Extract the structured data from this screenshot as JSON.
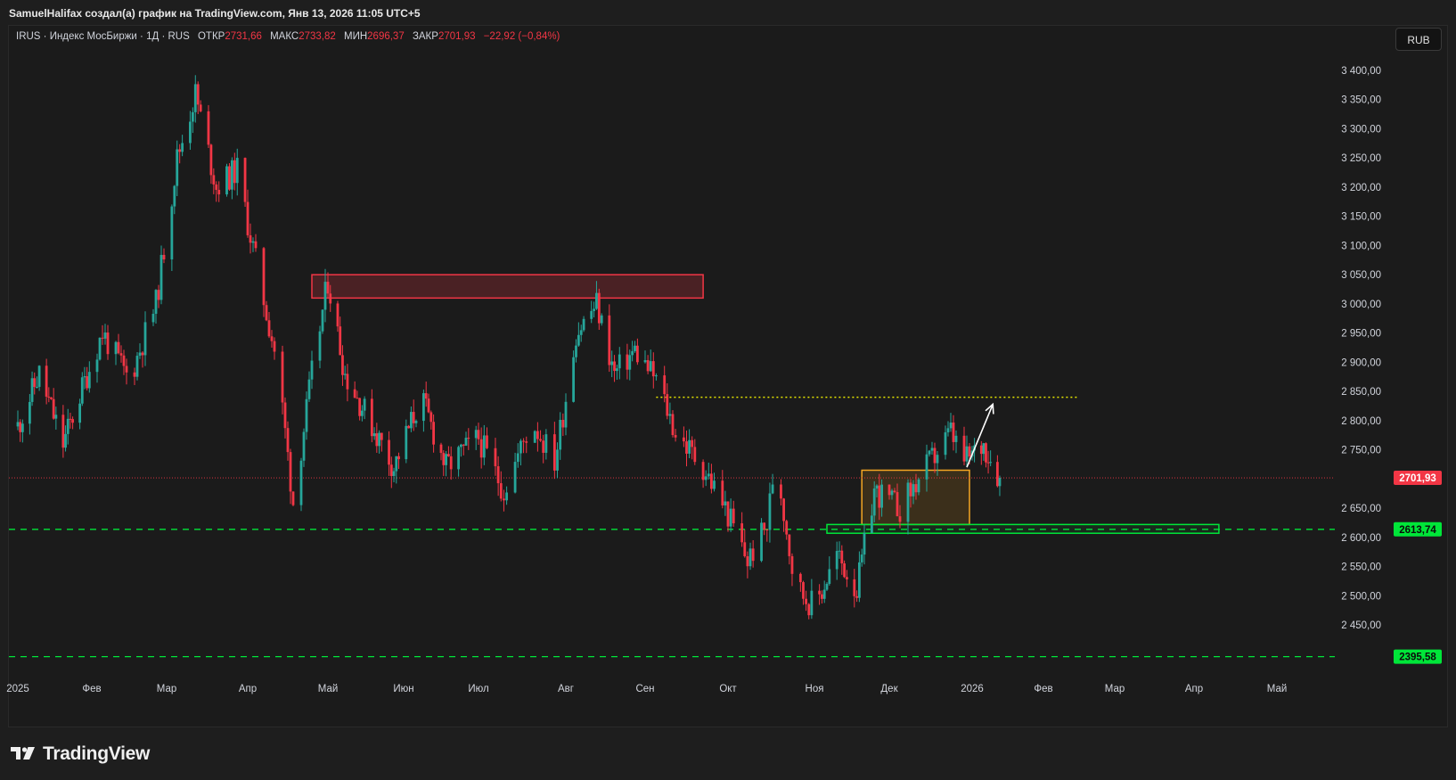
{
  "header": {
    "credit": "SamuelHalifax создал(а) график на TradingView.com, Янв 13, 2026 11:05 UTC+5"
  },
  "legend": {
    "symbol": "IRUS · Индекс МосБиржи · 1Д · RUS",
    "open_label": "ОТКР",
    "open": "2731,66",
    "high_label": "МАКС",
    "high": "2733,82",
    "low_label": "МИН",
    "low": "2696,37",
    "close_label": "ЗАКР",
    "close": "2701,93",
    "change": "−22,92 (−0,84%)"
  },
  "currency_button": "RUB",
  "brand": {
    "name": "TradingView"
  },
  "chart_data": {
    "type": "candlestick",
    "symbol": "IRUS",
    "interval": "1D",
    "currency": "RUB",
    "y_ticks": [
      "3 400,00",
      "3 350,00",
      "3 300,00",
      "3 250,00",
      "3 200,00",
      "3 150,00",
      "3 100,00",
      "3 050,00",
      "3 000,00",
      "2 950,00",
      "2 900,00",
      "2 850,00",
      "2 800,00",
      "2 750,00",
      "2 650,00",
      "2 600,00",
      "2 550,00",
      "2 500,00",
      "2 450,00"
    ],
    "y_tick_values": [
      3400,
      3350,
      3300,
      3250,
      3200,
      3150,
      3100,
      3050,
      3000,
      2950,
      2900,
      2850,
      2800,
      2750,
      2650,
      2600,
      2550,
      2500,
      2450
    ],
    "x_labels": [
      {
        "label": "2025",
        "date": "2025-01-01"
      },
      {
        "label": "Фев",
        "date": "2025-02-01"
      },
      {
        "label": "Мар",
        "date": "2025-03-01"
      },
      {
        "label": "Апр",
        "date": "2025-04-01"
      },
      {
        "label": "Май",
        "date": "2025-05-01"
      },
      {
        "label": "Июн",
        "date": "2025-06-01"
      },
      {
        "label": "Июл",
        "date": "2025-07-01"
      },
      {
        "label": "Авг",
        "date": "2025-08-01"
      },
      {
        "label": "Сен",
        "date": "2025-09-01"
      },
      {
        "label": "Окт",
        "date": "2025-10-01"
      },
      {
        "label": "Ноя",
        "date": "2025-11-01"
      },
      {
        "label": "Дек",
        "date": "2025-12-01"
      },
      {
        "label": "2026",
        "date": "2026-01-01"
      },
      {
        "label": "Фев",
        "date": "2026-02-01"
      },
      {
        "label": "Мар",
        "date": "2026-03-01"
      },
      {
        "label": "Апр",
        "date": "2026-04-01"
      },
      {
        "label": "Май",
        "date": "2026-05-01"
      }
    ],
    "ylim": [
      2380,
      3420
    ],
    "colors": {
      "up": "#26a69a",
      "down": "#f23645",
      "background": "#1b1b1b"
    },
    "path": [
      [
        "2025-01-01",
        2790
      ],
      [
        "2025-01-10",
        2880
      ],
      [
        "2025-01-20",
        2760
      ],
      [
        "2025-02-05",
        2950
      ],
      [
        "2025-02-15",
        2870
      ],
      [
        "2025-02-25",
        3000
      ],
      [
        "2025-03-05",
        3250
      ],
      [
        "2025-03-12",
        3360
      ],
      [
        "2025-03-20",
        3200
      ],
      [
        "2025-03-28",
        3230
      ],
      [
        "2025-04-05",
        3050
      ],
      [
        "2025-04-12",
        2900
      ],
      [
        "2025-04-18",
        2660
      ],
      [
        "2025-04-25",
        2880
      ],
      [
        "2025-05-01",
        3040
      ],
      [
        "2025-05-08",
        2880
      ],
      [
        "2025-05-18",
        2800
      ],
      [
        "2025-05-28",
        2720
      ],
      [
        "2025-06-08",
        2840
      ],
      [
        "2025-06-18",
        2720
      ],
      [
        "2025-07-01",
        2770
      ],
      [
        "2025-07-10",
        2680
      ],
      [
        "2025-07-20",
        2800
      ],
      [
        "2025-07-28",
        2730
      ],
      [
        "2025-08-05",
        2950
      ],
      [
        "2025-08-13",
        3000
      ],
      [
        "2025-08-20",
        2880
      ],
      [
        "2025-08-28",
        2920
      ],
      [
        "2025-09-05",
        2870
      ],
      [
        "2025-09-12",
        2780
      ],
      [
        "2025-09-22",
        2720
      ],
      [
        "2025-09-30",
        2650
      ],
      [
        "2025-10-08",
        2560
      ],
      [
        "2025-10-15",
        2620
      ],
      [
        "2025-10-18",
        2740
      ],
      [
        "2025-10-25",
        2520
      ],
      [
        "2025-11-01",
        2480
      ],
      [
        "2025-11-10",
        2570
      ],
      [
        "2025-11-18",
        2510
      ],
      [
        "2025-11-25",
        2680
      ],
      [
        "2025-12-05",
        2650
      ],
      [
        "2025-12-15",
        2720
      ],
      [
        "2025-12-24",
        2780
      ],
      [
        "2025-12-29",
        2730
      ],
      [
        "2026-01-06",
        2760
      ],
      [
        "2026-01-13",
        2702
      ]
    ],
    "last_price": {
      "label": "2701,93",
      "value": 2701.93
    },
    "levels": [
      {
        "label": "2613,74",
        "value": 2613.74,
        "style": "dashed",
        "color": "#00e639"
      },
      {
        "label": "2395,58",
        "value": 2395.58,
        "style": "dashed",
        "color": "#00e639"
      }
    ],
    "dotted_target": {
      "value": 2840,
      "from": "2025-09-05",
      "to": "2026-02-15",
      "color": "#e8e800"
    },
    "zones": [
      {
        "name": "resistance",
        "from": "2025-04-25",
        "to": "2025-09-22",
        "top": 3050,
        "bottom": 3010,
        "border": "#f23645",
        "fill": "rgba(242,54,69,0.22)"
      },
      {
        "name": "consolidation",
        "from": "2025-11-20",
        "to": "2025-12-31",
        "top": 2715,
        "bottom": 2622,
        "border": "#f5a623",
        "fill": "rgba(245,166,35,0.15)"
      },
      {
        "name": "support",
        "from": "2025-11-06",
        "to": "2026-04-10",
        "top": 2622,
        "bottom": 2607,
        "border": "#00e639",
        "fill": "rgba(0,230,57,0.08)"
      }
    ],
    "arrow": {
      "from_date": "2025-12-30",
      "from_value": 2720,
      "to_date": "2026-01-10",
      "to_value": 2828,
      "color": "#ffffff"
    }
  }
}
